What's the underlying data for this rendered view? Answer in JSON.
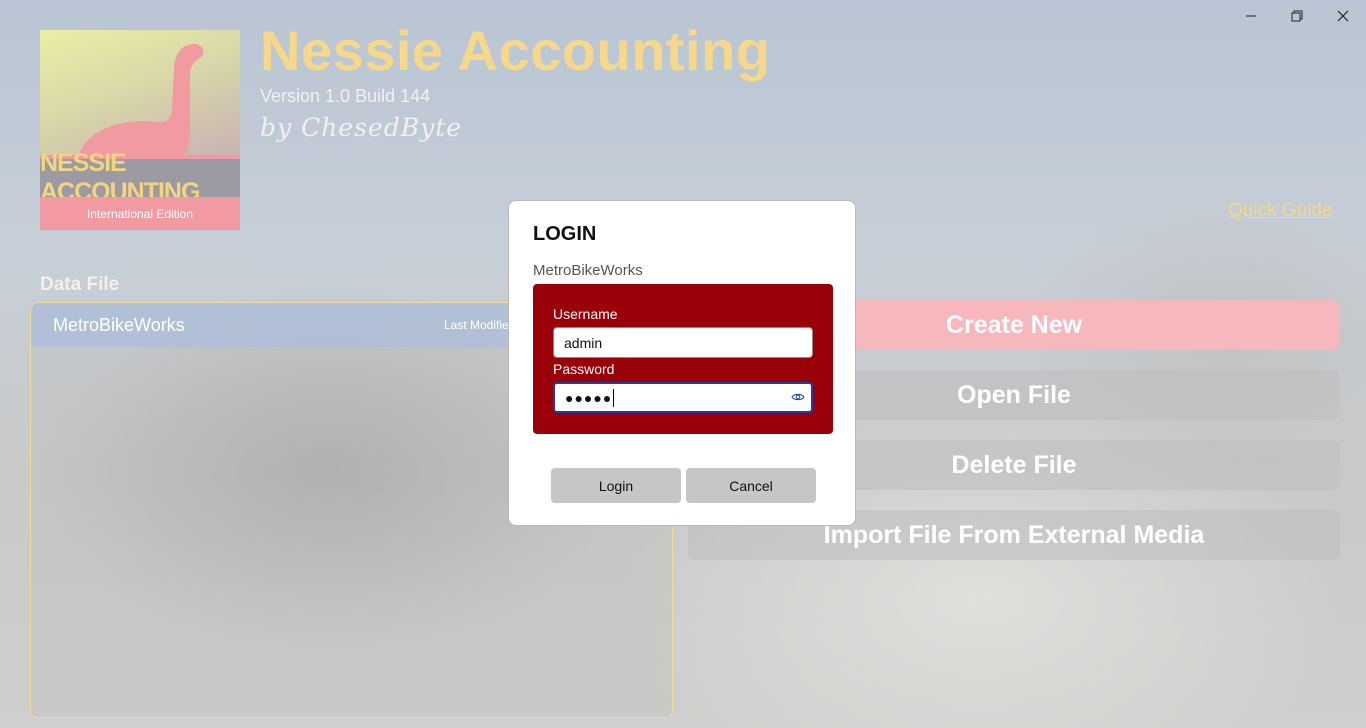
{
  "window": {
    "minimize_icon": "minimize-icon",
    "maximize_icon": "restore-icon",
    "close_icon": "close-icon"
  },
  "logo": {
    "banner_text": "NESSIE ACCOUNTING",
    "edition_text": "International Edition"
  },
  "header": {
    "title": "Nessie Accounting",
    "version": "Version 1.0 Build 144",
    "author": "by ChesedByte",
    "quick_guide": "Quick Guide"
  },
  "data_file": {
    "label": "Data File",
    "rows": [
      {
        "name": "MetroBikeWorks",
        "modified": "Last Modified"
      }
    ]
  },
  "actions": {
    "create": "Create New",
    "open": "Open File",
    "delete": "Delete File",
    "import": "Import File From External Media"
  },
  "login_dialog": {
    "title": "LOGIN",
    "file_name": "MetroBikeWorks",
    "username_label": "Username",
    "username_value": "admin",
    "password_label": "Password",
    "password_masked": "●●●●●",
    "login_button": "Login",
    "cancel_button": "Cancel"
  },
  "colors": {
    "accent_yellow": "#f5d88a",
    "create_pink": "#f6b8bd",
    "credential_red": "#9a0007",
    "focus_blue": "#1a3ea8"
  }
}
